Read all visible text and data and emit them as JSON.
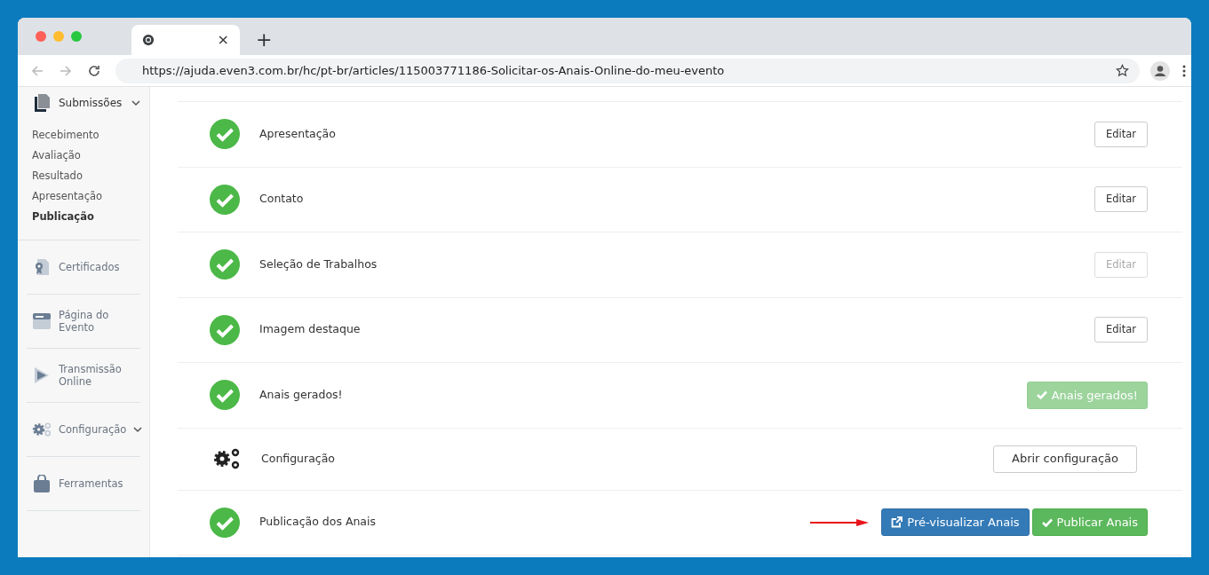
{
  "browser": {
    "tab": {
      "close": "×"
    },
    "new_tab": "+",
    "url": "https://ajuda.even3.com.br/hc/pt-br/articles/115003771186-Solicitar-os-Anais-Online-do-meu-evento"
  },
  "sidebar": {
    "section": {
      "label": "Submissões",
      "expanded": true,
      "items": [
        {
          "label": "Recebimento",
          "selected": false
        },
        {
          "label": "Avaliação",
          "selected": false
        },
        {
          "label": "Resultado",
          "selected": false
        },
        {
          "label": "Apresentação",
          "selected": false
        },
        {
          "label": "Publicação",
          "selected": true
        }
      ]
    },
    "items": [
      {
        "kind": "certificate",
        "label": "Certificados",
        "expandable": false
      },
      {
        "kind": "page",
        "label": "Página do Evento",
        "expandable": false
      },
      {
        "kind": "play",
        "label": "Transmissão Online",
        "expandable": false
      },
      {
        "kind": "gears",
        "label": "Configuração",
        "expandable": true
      },
      {
        "kind": "bag",
        "label": "Ferramentas",
        "expandable": false
      }
    ]
  },
  "steps": [
    {
      "kind": "step",
      "label": "Apresentação",
      "pointer_arrow": false,
      "actions": [
        {
          "kind": "outline",
          "label": "Editar",
          "disabled": false
        }
      ]
    },
    {
      "kind": "step",
      "label": "Contato",
      "pointer_arrow": false,
      "actions": [
        {
          "kind": "outline",
          "label": "Editar",
          "disabled": false
        }
      ]
    },
    {
      "kind": "step",
      "label": "Seleção de Trabalhos",
      "pointer_arrow": false,
      "actions": [
        {
          "kind": "outline",
          "label": "Editar",
          "disabled": true
        }
      ]
    },
    {
      "kind": "step",
      "label": "Imagem destaque",
      "pointer_arrow": false,
      "actions": [
        {
          "kind": "outline",
          "label": "Editar",
          "disabled": false
        }
      ]
    },
    {
      "kind": "step",
      "label": "Anais gerados!",
      "pointer_arrow": false,
      "actions": [
        {
          "kind": "success",
          "label": "Anais gerados!",
          "disabled": true
        }
      ]
    },
    {
      "kind": "settings",
      "label": "Configuração",
      "pointer_arrow": false,
      "actions": [
        {
          "kind": "outline-wide",
          "label": "Abrir configuração",
          "disabled": false
        }
      ]
    },
    {
      "kind": "step",
      "label": "Publicação dos Anais",
      "pointer_arrow": true,
      "actions": [
        {
          "kind": "primary",
          "label": "Pré-visualizar Anais",
          "disabled": false
        },
        {
          "kind": "success",
          "label": "Publicar Anais",
          "disabled": false
        }
      ]
    }
  ]
}
